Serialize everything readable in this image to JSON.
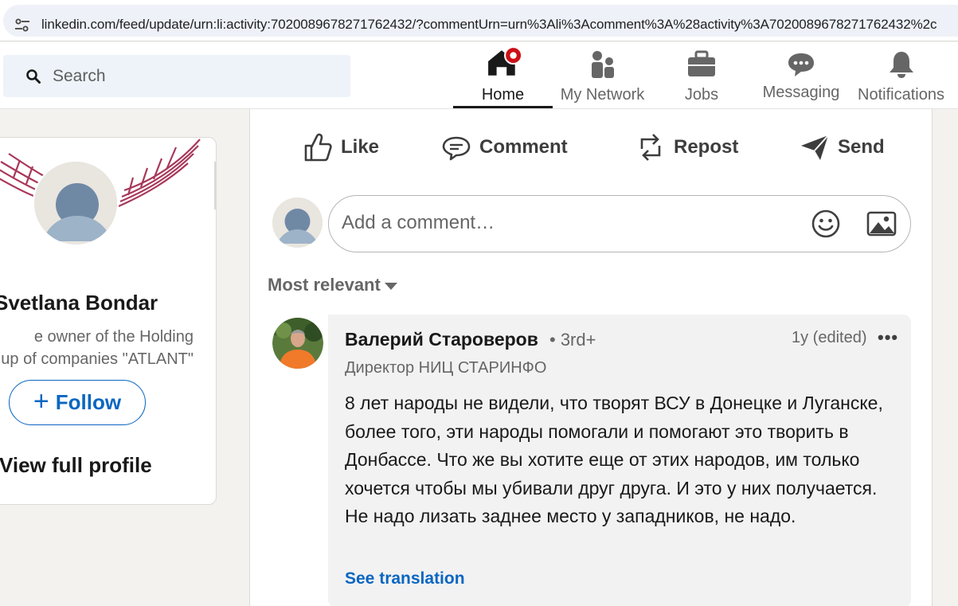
{
  "browser": {
    "url": "linkedin.com/feed/update/urn:li:activity:7020089678271762432/?commentUrn=urn%3Ali%3Acomment%3A%28activity%3A7020089678271762432%2c"
  },
  "nav": {
    "search_placeholder": "Search",
    "items": [
      {
        "label": "Home",
        "icon": "home-icon",
        "badge": true
      },
      {
        "label": "My Network",
        "icon": "people-icon"
      },
      {
        "label": "Jobs",
        "icon": "briefcase-icon"
      },
      {
        "label": "Messaging",
        "icon": "chat-icon"
      },
      {
        "label": "Notifications",
        "icon": "bell-icon"
      }
    ]
  },
  "profile": {
    "name": "Svetlana Bondar",
    "headline_line1": "e owner of the Holding",
    "headline_line2": "up of companies \"ATLANT\"",
    "follow_label": "Follow",
    "view_profile_label": "View full profile"
  },
  "post_actions": {
    "like": "Like",
    "comment": "Comment",
    "repost": "Repost",
    "send": "Send"
  },
  "comment_box": {
    "placeholder": "Add a comment…"
  },
  "sort": {
    "label": "Most relevant"
  },
  "comment": {
    "author": "Валерий Староверов",
    "degree": "• 3rd+",
    "time": "1y (edited)",
    "more": "•••",
    "title": "Директор НИЦ СТАРИНФО",
    "text": "8 лет народы не видели, что творят ВСУ в Донецке и Луганске, более того, эти народы помогали и помогают это творить в Донбассе. Что же вы хотите еще от этих народов, им только хочется чтобы мы убивали друг друга. И это у них получается. Не надо лизать заднее место у западников, не надо.",
    "see_translation": "See translation"
  },
  "colors": {
    "linkedin_blue": "#0a66c2",
    "badge_red": "#cc1016",
    "banner_wings": "#a8385a"
  }
}
